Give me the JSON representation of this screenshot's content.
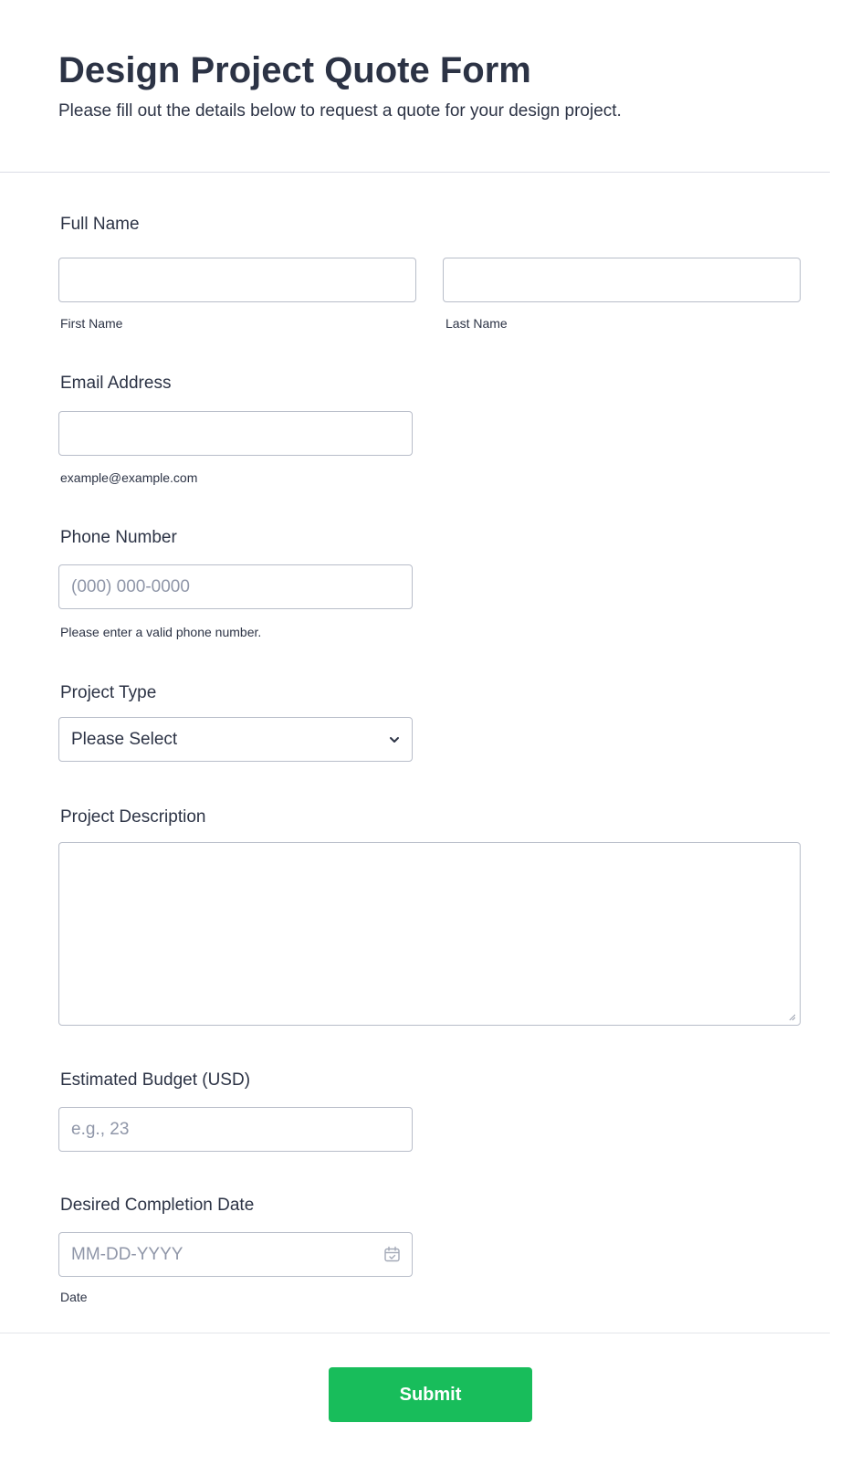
{
  "header": {
    "title": "Design Project Quote Form",
    "subtitle": "Please fill out the details below to request a quote for your design project."
  },
  "full_name": {
    "label": "Full Name",
    "first_value": "",
    "first_sublabel": "First Name",
    "last_value": "",
    "last_sublabel": "Last Name"
  },
  "email": {
    "label": "Email Address",
    "value": "",
    "sublabel": "example@example.com"
  },
  "phone": {
    "label": "Phone Number",
    "placeholder": "(000) 000-0000",
    "sublabel": "Please enter a valid phone number."
  },
  "project_type": {
    "label": "Project Type",
    "selected": "Please Select",
    "icon": "chevron-down-icon"
  },
  "project_description": {
    "label": "Project Description",
    "value": ""
  },
  "budget": {
    "label": "Estimated Budget (USD)",
    "placeholder": "e.g., 23"
  },
  "completion_date": {
    "label": "Desired Completion Date",
    "placeholder": "MM-DD-YYYY",
    "sublabel": "Date",
    "icon": "calendar-icon"
  },
  "submit": {
    "label": "Submit",
    "color": "#18bd5b"
  }
}
